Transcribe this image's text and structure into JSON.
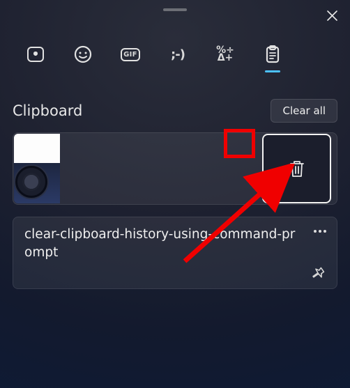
{
  "header": {
    "section_title": "Clipboard",
    "clear_all_label": "Clear all"
  },
  "tabs": {
    "gif_label": "GIF",
    "kaomoji_label": ";-)",
    "symbols_label": "%÷\nΔ+"
  },
  "items": [
    {
      "type": "image",
      "alt": "screenshot-thumbnail"
    },
    {
      "type": "text",
      "text": "clear-clipboard-history-using-command-prompt"
    }
  ],
  "popup": {
    "action": "delete"
  }
}
